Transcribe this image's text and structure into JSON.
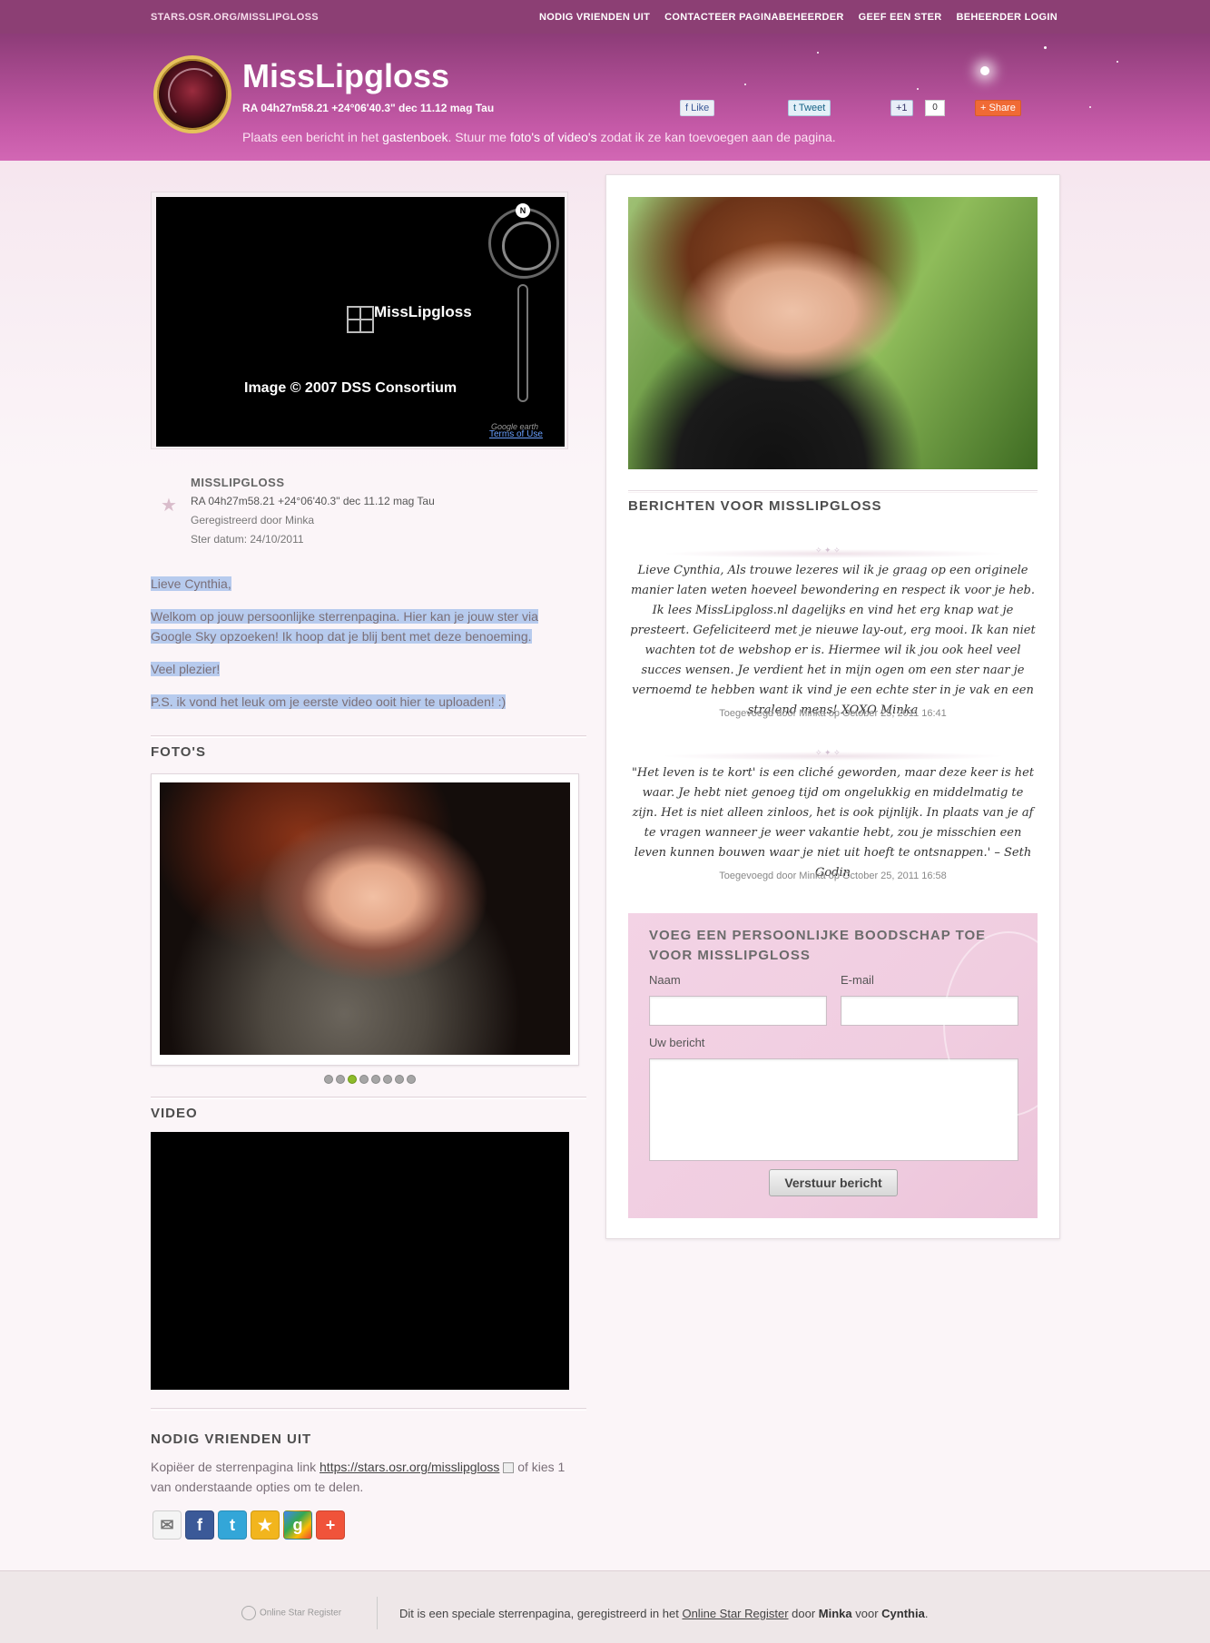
{
  "topbar": {
    "site": "STARS.OSR.ORG/MISSLIPGLOSS",
    "nav": [
      "NODIG VRIENDEN UIT",
      "CONTACTEER PAGINABEHEERDER",
      "GEEF EEN STER",
      "BEHEERDER LOGIN"
    ]
  },
  "header": {
    "title": "MissLipgloss",
    "coords": "RA 04h27m58.21 +24°06'40.3\" dec 11.12 mag Tau",
    "note_pre": "Plaats een bericht in het ",
    "note_guestbook": "gastenboek",
    "note_mid": ". Stuur me ",
    "note_media": "foto's of video's",
    "note_post": " zodat ik ze kan toevoegen aan de pagina.",
    "social": {
      "like": "Like",
      "tweet": "Tweet",
      "plusone": "+1",
      "plusone_count": "0",
      "share": "Share"
    }
  },
  "map": {
    "label": "MissLipgloss",
    "copyright": "Image © 2007 DSS Consortium",
    "north": "N",
    "google": "Google earth",
    "terms": "Terms of Use"
  },
  "star": {
    "name": "MISSLIPGLOSS",
    "coords": "RA 04h27m58.21 +24°06'40.3\" dec 11.12 mag Tau",
    "registered": "Geregistreerd door Minka",
    "date": "Ster datum: 24/10/2011"
  },
  "letter": [
    "Lieve Cynthia,",
    "Welkom op jouw persoonlijke sterrenpagina. Hier kan je jouw ster via Google Sky opzoeken! Ik hoop dat je blij bent met deze benoeming.",
    "Veel plezier!",
    "P.S. ik vond het leuk om je eerste video ooit hier te uploaden! :)"
  ],
  "sections": {
    "photos": "FOTO'S",
    "video": "VIDEO",
    "invite": "NODIG VRIENDEN UIT"
  },
  "photos": {
    "count": 8,
    "active": 3
  },
  "invite": {
    "text_pre": "Kopiëer de sterrenpagina link ",
    "link": "https://stars.osr.org/misslipgloss",
    "text_post": " of kies 1 van onderstaande opties om te delen.",
    "icons": [
      "email-icon",
      "facebook-icon",
      "twitter-icon",
      "favorite-icon",
      "google-icon",
      "addthis-icon"
    ]
  },
  "messages": {
    "title": "BERICHTEN VOOR MISSLIPGLOSS",
    "items": [
      {
        "text": "Lieve Cynthia, Als trouwe lezeres wil ik je graag op een originele manier laten weten hoeveel bewondering en respect ik voor je heb. Ik lees MissLipgloss.nl dagelijks en vind het erg knap wat je presteert. Gefeliciteerd met je nieuwe lay-out, erg mooi. Ik kan niet wachten tot de webshop er is. Hiermee wil ik jou ook heel veel succes wensen. Je verdient het in mijn ogen om een ster naar je vernoemd te hebben want ik vind je een echte ster in je vak en een stralend mens! XOXO Minka",
        "meta": "Toegevoegd door Minka op October 25, 2011 16:41"
      },
      {
        "text": "\"Het leven is te kort' is een cliché geworden, maar deze keer is het waar. Je hebt niet genoeg tijd om ongelukkig en middelmatig te zijn. Het is niet alleen zinloos, het is ook pijnlijk. In plaats van je af te vragen wanneer je weer vakantie hebt, zou je misschien een leven kunnen bouwen waar je niet uit hoeft te ontsnappen.' – Seth Godin",
        "meta": "Toegevoegd door Minka op October 25, 2011 16:58"
      }
    ]
  },
  "form": {
    "title": "VOEG EEN PERSOONLIJKE BOODSCHAP TOE VOOR MISSLIPGLOSS",
    "name_label": "Naam",
    "email_label": "E-mail",
    "message_label": "Uw bericht",
    "name_value": "",
    "email_value": "",
    "message_value": "",
    "submit": "Verstuur bericht"
  },
  "footer": {
    "logo": "Online Star Register",
    "text_pre": "Dit is een speciale sterrenpagina, geregistreerd in het ",
    "link": "Online Star Register",
    "text_mid": " door ",
    "by": "Minka",
    "text_mid2": " voor ",
    "for": "Cynthia",
    "text_post": "."
  },
  "colors": {
    "topbar": "#8c3f74",
    "header_bottom": "#d267b4",
    "selection": "#b7cbee",
    "active_dot": "#8dbb2a"
  }
}
